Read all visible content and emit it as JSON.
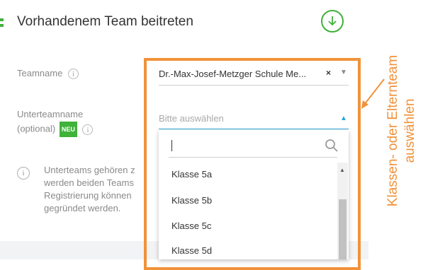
{
  "header": {
    "title": "Vorhandenem Team beitreten",
    "download_icon": "download-circle-icon"
  },
  "form": {
    "teamname_label": "Teamname",
    "teamname_value": "Dr.-Max-Josef-Metzger Schule Me...",
    "clear_symbol": "×",
    "subteam_label_line1": "Unterteamname",
    "subteam_label_line2": "(optional)",
    "new_badge": "NEU",
    "subteam_placeholder": "Bitte auswählen",
    "info_symbol": "i"
  },
  "dropdown": {
    "search_value": "",
    "options": [
      "Klasse 5a",
      "Klasse 5b",
      "Klasse 5c",
      "Klasse 5d"
    ]
  },
  "note": {
    "text": "Unterteams gehören z\nwerden beiden Teams\nRegistrierung können\ngegründet werden."
  },
  "annotation": {
    "line1": "Klassen- oder Elternteam",
    "line2": "auswählen",
    "color": "#f0923a"
  },
  "colors": {
    "accent_green": "#3fb23a",
    "focus_blue": "#2aa6e0"
  }
}
